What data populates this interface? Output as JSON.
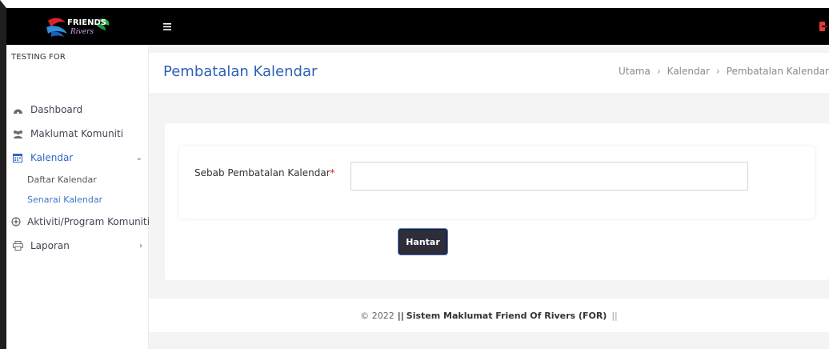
{
  "topbar": {
    "logo_text": "FRIENDS of Rivers",
    "menu_icon": "hamburger-icon",
    "logout_icon": "logout-icon",
    "colors": {
      "background": "#000000",
      "logout": "#e53935"
    }
  },
  "sidebar": {
    "title": "TESTING FOR",
    "items": [
      {
        "label": "Dashboard",
        "icon": "dashboard-icon",
        "active": false
      },
      {
        "label": "Maklumat Komuniti",
        "icon": "users-icon",
        "active": false
      },
      {
        "label": "Kalendar",
        "icon": "calendar-icon",
        "active": true,
        "chevron": "⌄",
        "children": [
          {
            "label": "Daftar Kalendar",
            "active": false
          },
          {
            "label": "Senarai Kalendar",
            "active": true
          }
        ]
      },
      {
        "label": "Aktiviti/Program Komuniti",
        "icon": "network-icon",
        "active": false
      },
      {
        "label": "Laporan",
        "icon": "print-icon",
        "active": false,
        "chevron": "›"
      }
    ]
  },
  "header": {
    "page_title": "Pembatalan Kalendar",
    "breadcrumb": [
      "Utama",
      "Kalendar",
      "Pembatalan Kalendar"
    ],
    "breadcrumb_separator": "›"
  },
  "form": {
    "field_label": "Sebab Pembatalan Kalendar",
    "required_mark": "*",
    "field_value": "",
    "field_placeholder": "",
    "submit_label": "Hantar"
  },
  "footer": {
    "prefix": "© 2022",
    "pipes_left": "||",
    "system_name": "Sistem Maklumat Friend Of Rivers (FOR)",
    "pipes_right": "||"
  },
  "colors": {
    "accent": "#2f62b5",
    "active_link": "#3a78c9",
    "required": "#e02424",
    "button": "#2e2e3a"
  }
}
